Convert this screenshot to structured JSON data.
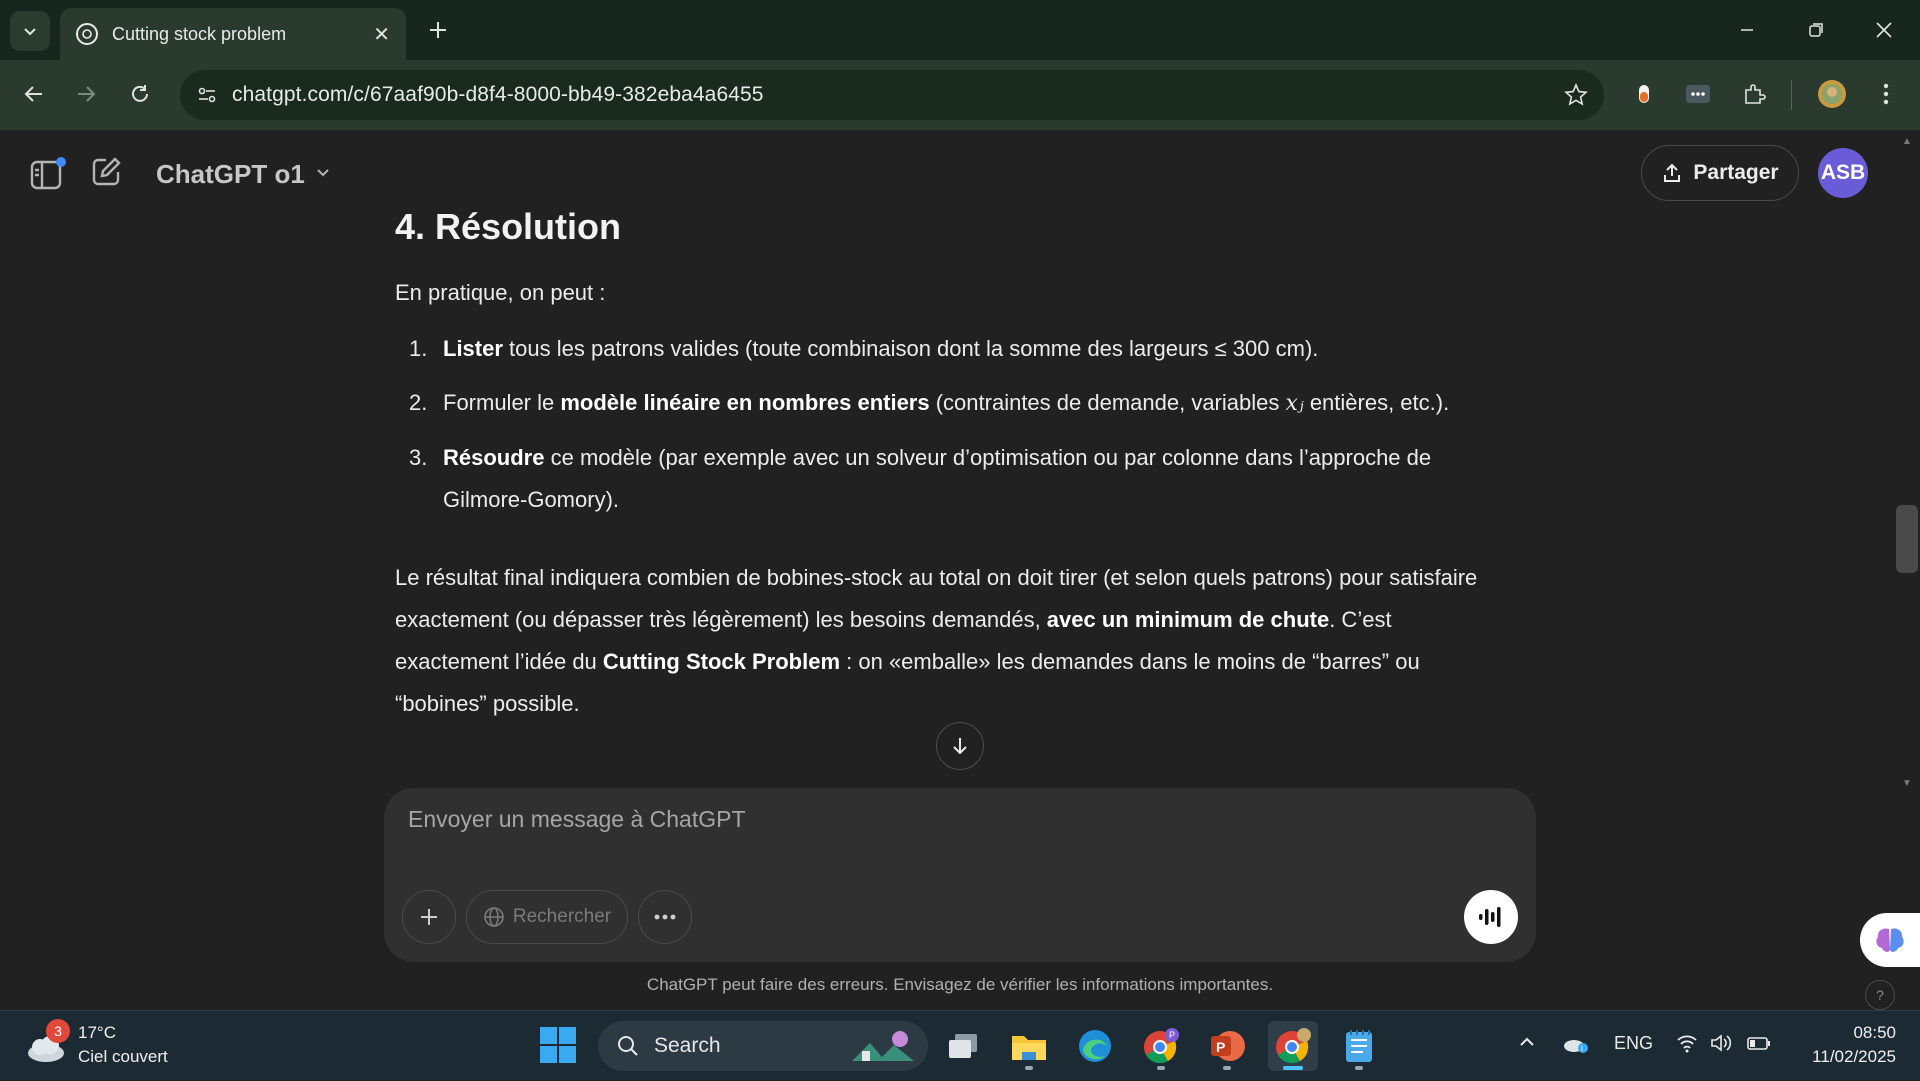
{
  "browser": {
    "tab_title": "Cutting stock problem",
    "url": "chatgpt.com/c/67aaf90b-d8f4-8000-bb49-382eba4a6455"
  },
  "header": {
    "model_name": "ChatGPT o1",
    "share_label": "Partager",
    "avatar_initials": "ASB"
  },
  "message": {
    "heading": "4. Résolution",
    "intro": "En pratique, on peut :",
    "steps": [
      {
        "num": "1.",
        "bold": "Lister",
        "text": " tous les patrons valides (toute combinaison dont la somme des largeurs ≤ 300 cm)."
      },
      {
        "num": "2.",
        "pre": "Formuler le ",
        "bold": "modèle linéaire en nombres entiers",
        "text_a": " (contraintes de demande, variables ",
        "math": "xⱼ",
        "text_b": " entières, etc.)."
      },
      {
        "num": "3.",
        "bold": "Résoudre",
        "text": " ce modèle (par exemple avec un solveur d’optimisation ou par colonne dans l’approche de Gilmore-Gomory)."
      }
    ],
    "conclusion": {
      "part1": "Le résultat final indiquera combien de bobines-stock au total on doit tirer (et selon quels patrons) pour satisfaire exactement (ou dépasser très légèrement) les besoins demandés, ",
      "bold1": "avec un minimum de chute",
      "part2": ". C’est exactement l’idée du ",
      "bold2": "Cutting Stock Problem",
      "part3": " : on «emballe» les demandes dans le moins de “barres” ou “bobines” possible."
    }
  },
  "composer": {
    "placeholder": "Envoyer un message à ChatGPT",
    "search_label": "Rechercher"
  },
  "disclaimer": "ChatGPT peut faire des erreurs. Envisagez de vérifier les informations importantes.",
  "taskbar": {
    "weather_temp": "17°C",
    "weather_desc": "Ciel couvert",
    "weather_badge": "3",
    "search_label": "Search",
    "language": "ENG",
    "time": "08:50",
    "date": "11/02/2025"
  },
  "colors": {
    "chrome_bg": "#17271d",
    "toolbar_bg": "#2b3a2f",
    "page_bg": "#212121",
    "composer_bg": "#303030",
    "avatar_bg": "#6a5cd6",
    "taskbar_bg": "#1c2a33"
  }
}
